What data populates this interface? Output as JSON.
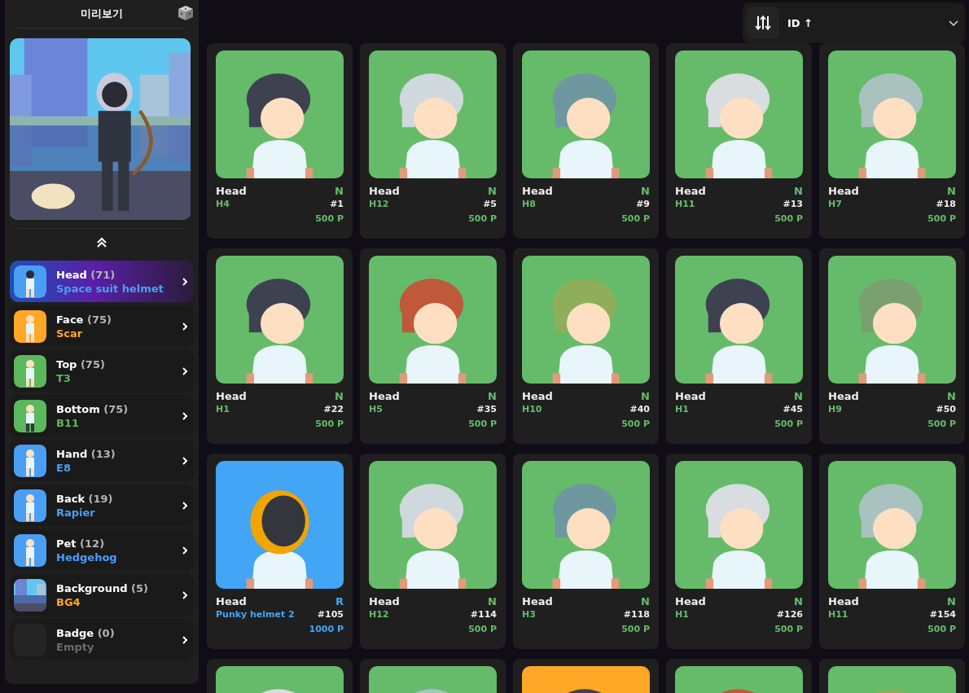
{
  "sidebar": {
    "title": "미리보기",
    "categories": [
      {
        "name": "Head",
        "count": "(71)",
        "value": "Space suit helmet",
        "color": "#4a9ff5",
        "kind": "figure",
        "selected": true
      },
      {
        "name": "Face",
        "count": "(75)",
        "value": "Scar",
        "color": "#ffa726",
        "kind": "figure",
        "selected": false
      },
      {
        "name": "Top",
        "count": "(75)",
        "value": "T3",
        "color": "#5cb85c",
        "kind": "figure",
        "selected": false
      },
      {
        "name": "Bottom",
        "count": "(75)",
        "value": "B11",
        "color": "#5cb85c",
        "kind": "figure",
        "selected": false
      },
      {
        "name": "Hand",
        "count": "(13)",
        "value": "E8",
        "color": "#4a9ff5",
        "kind": "figure",
        "selected": false
      },
      {
        "name": "Back",
        "count": "(19)",
        "value": "Rapier",
        "color": "#4a9ff5",
        "kind": "figure",
        "selected": false
      },
      {
        "name": "Pet",
        "count": "(12)",
        "value": "Hedgehog",
        "color": "#4a9ff5",
        "kind": "figure",
        "selected": false
      },
      {
        "name": "Background",
        "count": "(5)",
        "value": "BG4",
        "color": "#ffa726",
        "kind": "scene",
        "selected": false
      },
      {
        "name": "Badge",
        "count": "(0)",
        "value": "Empty",
        "color": "#6b6b6b",
        "kind": "empty",
        "selected": false
      }
    ]
  },
  "sort": {
    "label": "ID ↑"
  },
  "items": [
    {
      "category": "Head",
      "rarity": "N",
      "name": "H4",
      "id": "#1",
      "price": "500 P",
      "color": "#66bb6a"
    },
    {
      "category": "Head",
      "rarity": "N",
      "name": "H12",
      "id": "#5",
      "price": "500 P",
      "color": "#66bb6a"
    },
    {
      "category": "Head",
      "rarity": "N",
      "name": "H8",
      "id": "#9",
      "price": "500 P",
      "color": "#66bb6a"
    },
    {
      "category": "Head",
      "rarity": "N",
      "name": "H11",
      "id": "#13",
      "price": "500 P",
      "color": "#66bb6a"
    },
    {
      "category": "Head",
      "rarity": "N",
      "name": "H7",
      "id": "#18",
      "price": "500 P",
      "color": "#66bb6a"
    },
    {
      "category": "Head",
      "rarity": "N",
      "name": "H1",
      "id": "#22",
      "price": "500 P",
      "color": "#66bb6a"
    },
    {
      "category": "Head",
      "rarity": "N",
      "name": "H5",
      "id": "#35",
      "price": "500 P",
      "color": "#66bb6a"
    },
    {
      "category": "Head",
      "rarity": "N",
      "name": "H10",
      "id": "#40",
      "price": "500 P",
      "color": "#66bb6a"
    },
    {
      "category": "Head",
      "rarity": "N",
      "name": "H1",
      "id": "#45",
      "price": "500 P",
      "color": "#66bb6a"
    },
    {
      "category": "Head",
      "rarity": "N",
      "name": "H9",
      "id": "#50",
      "price": "500 P",
      "color": "#66bb6a"
    },
    {
      "category": "Head",
      "rarity": "R",
      "name": "Punky helmet 2",
      "id": "#105",
      "price": "1000 P",
      "color": "#42a5f5"
    },
    {
      "category": "Head",
      "rarity": "N",
      "name": "H12",
      "id": "#114",
      "price": "500 P",
      "color": "#66bb6a"
    },
    {
      "category": "Head",
      "rarity": "N",
      "name": "H3",
      "id": "#118",
      "price": "500 P",
      "color": "#66bb6a"
    },
    {
      "category": "Head",
      "rarity": "N",
      "name": "H1",
      "id": "#126",
      "price": "500 P",
      "color": "#66bb6a"
    },
    {
      "category": "Head",
      "rarity": "N",
      "name": "H11",
      "id": "#154",
      "price": "500 P",
      "color": "#66bb6a"
    }
  ]
}
